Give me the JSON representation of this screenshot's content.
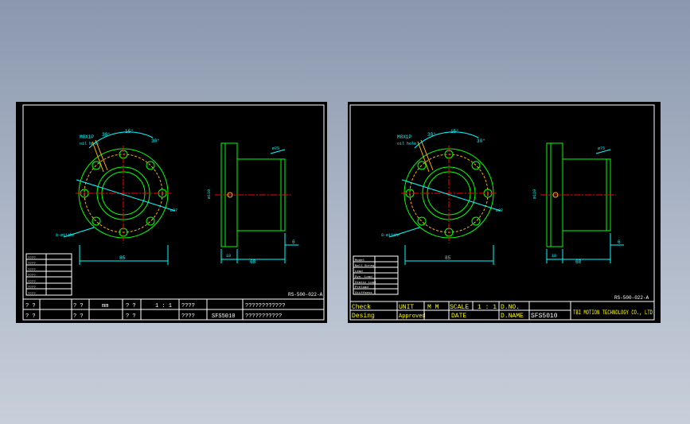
{
  "colors": {
    "background_top": "#8a97ad",
    "sheet": "#000000",
    "border": "#ffffff",
    "part": "#00ff00",
    "centerline": "#ff0000",
    "hidden": "#ffb000",
    "dimension": "#00ffff",
    "text_yellow": "#ffff00",
    "text_white": "#ffffff"
  },
  "left_sheet": {
    "drawing_no": "RS-500-022-A",
    "dims": {
      "angle_a": "30°",
      "angle_b": "15°",
      "angle_c": "30°",
      "m8": "M8X1P",
      "oil": "oil hole",
      "bolt": "8-ø11thr",
      "pcd": "ø97",
      "width": "85",
      "flange_dia": "ø110",
      "boss_dia": "ø75",
      "len1": "18",
      "len2": "68",
      "gap": "6"
    },
    "spec_table": [
      "????",
      "????",
      "????",
      "????",
      "????",
      "????",
      "????"
    ],
    "title_block": {
      "r1": [
        "? ?",
        "? ?",
        "mm",
        "? ?",
        "1 : 1",
        "????",
        "????????????"
      ],
      "r2": [
        "? ?",
        "? ?",
        "? ?",
        "????",
        "SFS5010",
        "???????????"
      ]
    }
  },
  "right_sheet": {
    "drawing_no": "RS-500-022-A",
    "dims": {
      "angle_a": "30°",
      "angle_b": "15°",
      "angle_c": "30°",
      "m8": "M8X1P",
      "oil": "oil hole",
      "bolt": "8-ø11thr",
      "pcd": "ø97",
      "width": "85",
      "flange_dia": "ø110",
      "boss_dia": "ø75",
      "len1": "18",
      "len2": "68",
      "gap": "6"
    },
    "spec_table": [
      "Model",
      "Ball Screw",
      "Lead",
      "Dyn. Load",
      "Static Load",
      "Preload",
      "Stiffness"
    ],
    "title_block": {
      "check": "Check",
      "unit": "UNIT",
      "mm": "M M",
      "scale": "SCALE",
      "scale_val": "1 : 1",
      "dno": "D.NO.",
      "design": "Desing",
      "approved": "Approved",
      "date": "DATE",
      "dname": "D.NAME",
      "dname_val": "SFS5010",
      "company": "TBI MOTION TECHNOLOGY CO., LTD"
    }
  }
}
